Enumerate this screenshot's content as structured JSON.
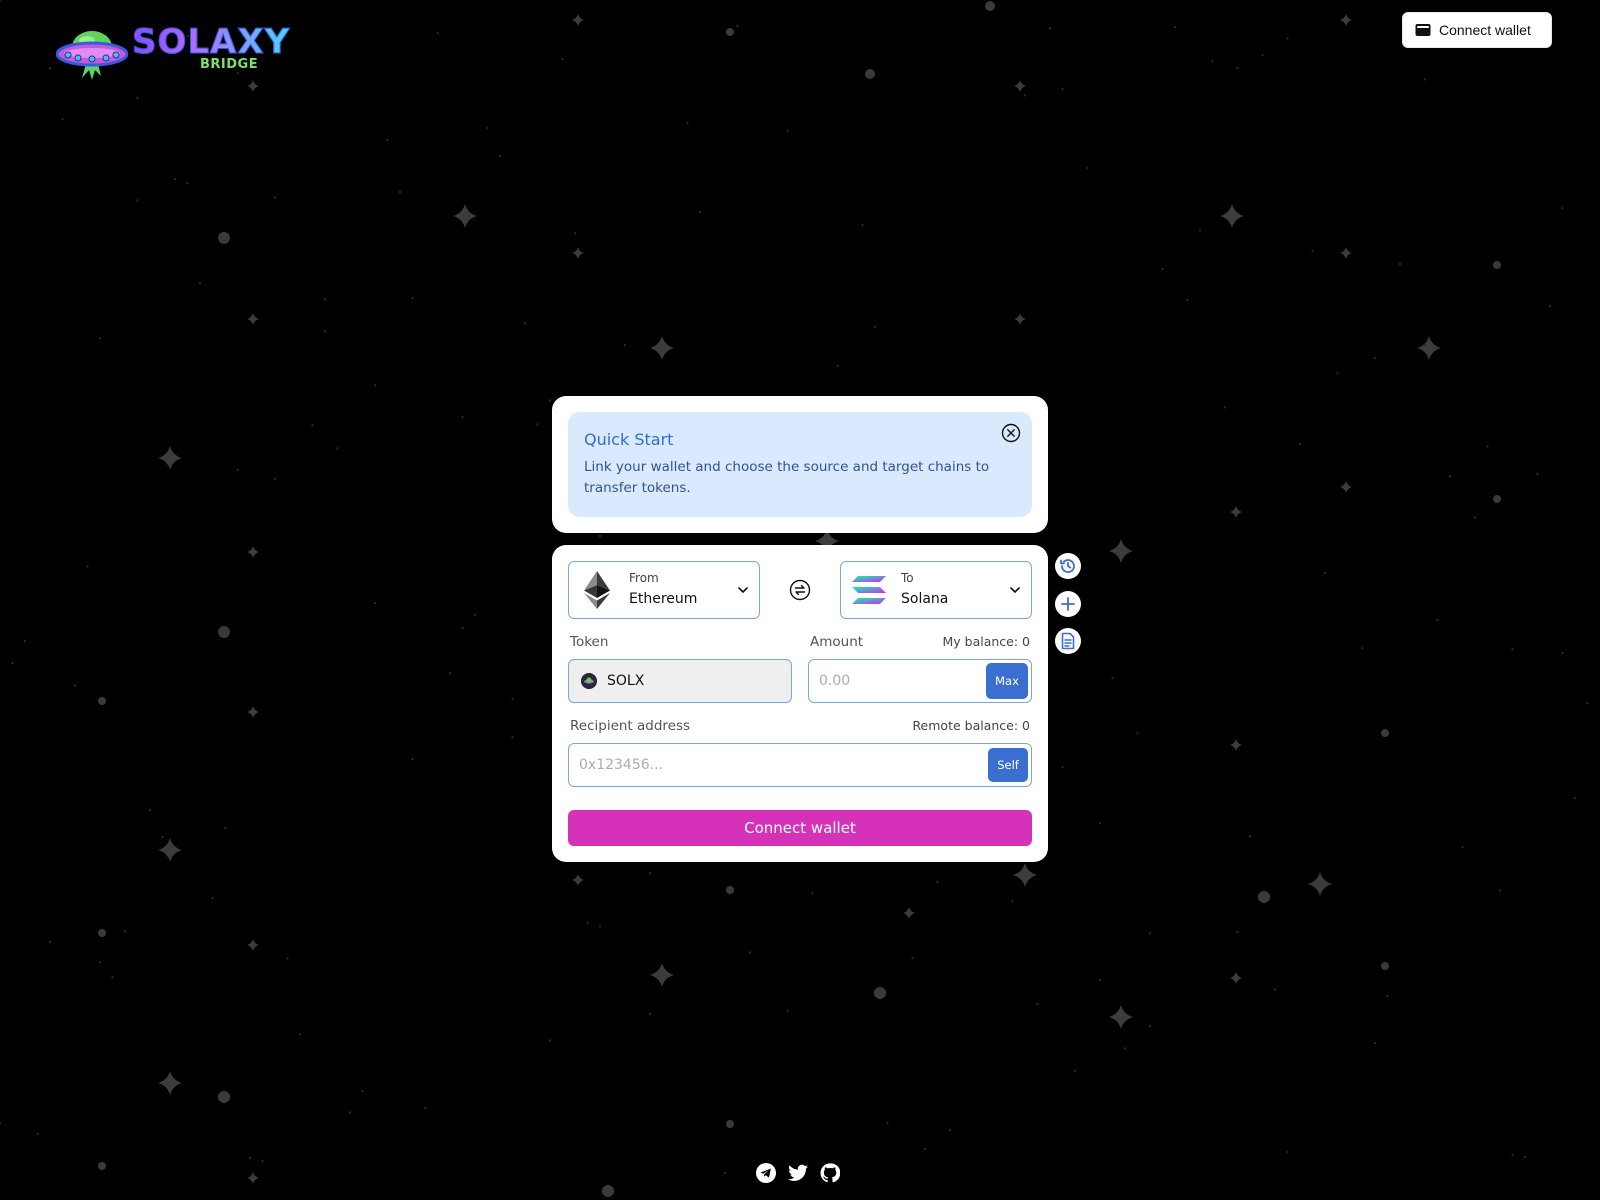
{
  "brand": {
    "name": "SOLAXY",
    "sub": "BRIDGE"
  },
  "header": {
    "connect_label": "Connect wallet",
    "wallet_icon": "wallet-icon"
  },
  "quick_start": {
    "title": "Quick Start",
    "text": "Link your wallet and choose the source and target chains to transfer tokens.",
    "close_icon": "close-circle-icon"
  },
  "bridge": {
    "from": {
      "label": "From",
      "value": "Ethereum",
      "icon": "ethereum-icon"
    },
    "to": {
      "label": "To",
      "value": "Solana",
      "icon": "solana-icon"
    },
    "token_label": "Token",
    "token_value": "SOLX",
    "amount_label": "Amount",
    "my_balance": "My balance: 0",
    "amount_placeholder": "0.00",
    "max_label": "Max",
    "recipient_label": "Recipient address",
    "remote_balance": "Remote balance: 0",
    "recipient_placeholder": "0x123456...",
    "self_label": "Self",
    "connect_label": "Connect wallet"
  },
  "side_actions": [
    "history-icon",
    "plus-icon",
    "document-icon"
  ],
  "footer": [
    "telegram-icon",
    "twitter-icon",
    "github-icon"
  ],
  "colors": {
    "accent": "#d632b9",
    "primary_blue": "#3b6fcf",
    "quick_start_bg": "#dbe9ff",
    "field_border": "#7fa6db"
  }
}
